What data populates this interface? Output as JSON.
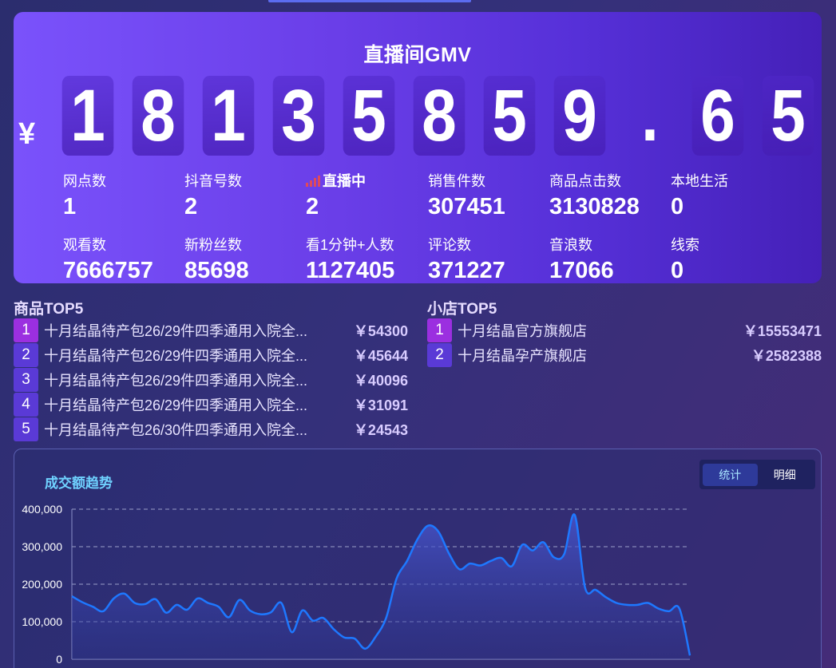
{
  "hero": {
    "title": "直播间GMV",
    "currency": "¥",
    "digits": [
      "1",
      "8",
      "1",
      "3",
      "5",
      "8",
      "5",
      "9",
      ".",
      "6",
      "5"
    ]
  },
  "stats_row1": [
    {
      "label": "网点数",
      "value": "1"
    },
    {
      "label": "抖音号数",
      "value": "2"
    },
    {
      "label": "直播中",
      "value": "2",
      "live": true
    },
    {
      "label": "销售件数",
      "value": "307451"
    },
    {
      "label": "商品点击数",
      "value": "3130828"
    },
    {
      "label": "本地生活",
      "value": "0"
    }
  ],
  "stats_row2": [
    {
      "label": "观看数",
      "value": "7666757"
    },
    {
      "label": "新粉丝数",
      "value": "85698"
    },
    {
      "label": "看1分钟+人数",
      "value": "1127405"
    },
    {
      "label": "评论数",
      "value": "371227"
    },
    {
      "label": "音浪数",
      "value": "17066"
    },
    {
      "label": "线索",
      "value": "0"
    }
  ],
  "products": {
    "title": "商品TOP5",
    "items": [
      {
        "rank": "1",
        "name": "十月结晶待产包26/29件四季通用入院全...",
        "amount": "￥54300"
      },
      {
        "rank": "2",
        "name": "十月结晶待产包26/29件四季通用入院全...",
        "amount": "￥45644"
      },
      {
        "rank": "3",
        "name": "十月结晶待产包26/29件四季通用入院全...",
        "amount": "￥40096"
      },
      {
        "rank": "4",
        "name": "十月结晶待产包26/29件四季通用入院全...",
        "amount": "￥31091"
      },
      {
        "rank": "5",
        "name": "十月结晶待产包26/30件四季通用入院全...",
        "amount": "￥24543"
      }
    ]
  },
  "shops": {
    "title": "小店TOP5",
    "items": [
      {
        "rank": "1",
        "name": "十月结晶官方旗舰店",
        "amount": "￥15553471"
      },
      {
        "rank": "2",
        "name": "十月结晶孕产旗舰店",
        "amount": "￥2582388"
      }
    ]
  },
  "trend": {
    "title": "成交额趋势",
    "tabs": [
      {
        "label": "统计",
        "active": true
      },
      {
        "label": "明细",
        "active": false
      }
    ]
  },
  "chart_data": {
    "type": "area",
    "title": "成交额趋势",
    "y_ticks": [
      "0",
      "100,000",
      "200,000",
      "300,000",
      "400,000"
    ],
    "ylim": [
      0,
      400000
    ],
    "grid": true,
    "color": "#1e78ff",
    "values": [
      168000,
      152000,
      140000,
      128000,
      162000,
      175000,
      150000,
      147000,
      160000,
      124000,
      145000,
      132000,
      162000,
      150000,
      140000,
      112000,
      158000,
      130000,
      120000,
      125000,
      150000,
      72000,
      130000,
      103000,
      110000,
      80000,
      58000,
      55000,
      28000,
      60000,
      110000,
      215000,
      262000,
      320000,
      356000,
      340000,
      282000,
      240000,
      255000,
      250000,
      262000,
      270000,
      248000,
      305000,
      290000,
      312000,
      272000,
      280000,
      385000,
      190000,
      185000,
      165000,
      150000,
      145000,
      145000,
      150000,
      135000,
      128000,
      135000,
      10000
    ]
  }
}
